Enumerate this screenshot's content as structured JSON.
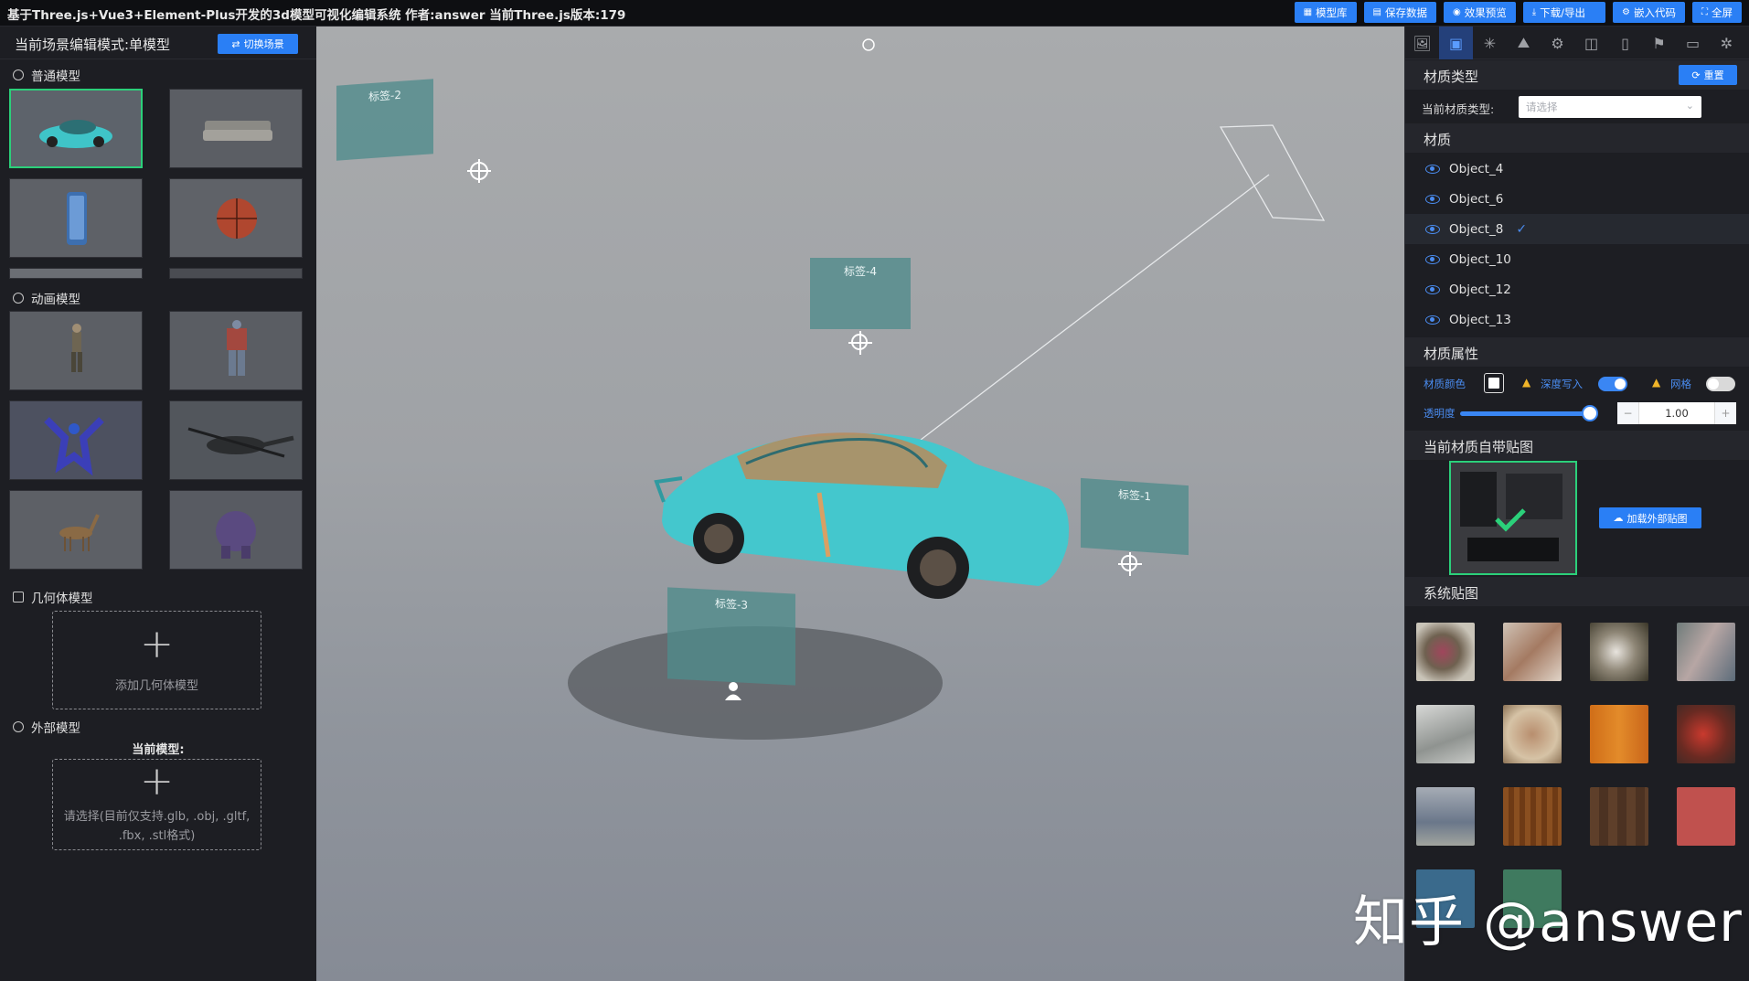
{
  "topbar": {
    "title": "基于Three.js+Vue3+Element-Plus开发的3d模型可视化编辑系统 作者:answer 当前Three.js版本:179",
    "buttons": [
      {
        "label": "模型库",
        "icon": "grid-icon"
      },
      {
        "label": "保存数据",
        "icon": "document-icon"
      },
      {
        "label": "效果预览",
        "icon": "eye-icon"
      },
      {
        "label": "下载/导出",
        "icon": "download-icon"
      },
      {
        "label": "嵌入代码",
        "icon": "gear-icon"
      },
      {
        "label": "全屏",
        "icon": "fullscreen-icon"
      }
    ]
  },
  "left": {
    "header_title": "当前场景编辑模式:单模型",
    "switch_label": "切换场景",
    "sections": {
      "normal": "普通模型",
      "animation": "动画模型",
      "geometry": "几何体模型",
      "external": "外部模型"
    },
    "add_geometry": "添加几何体模型",
    "current_model_label": "当前模型:",
    "upload_hint": "请选择(目前仅支持.glb, .obj, .gltf, .fbx, .stl格式)"
  },
  "viewport": {
    "labels": [
      "标签-2",
      "标签-4",
      "标签-1",
      "标签-3"
    ]
  },
  "right": {
    "material_type_title": "材质类型",
    "reset_label": "重置",
    "current_type_label": "当前材质类型:",
    "select_placeholder": "请选择",
    "material_title": "材质",
    "materials": [
      "Object_4",
      "Object_6",
      "Object_8",
      "Object_10",
      "Object_12",
      "Object_13"
    ],
    "selected_material": "Object_8",
    "props_title": "材质属性",
    "color_label": "材质颜色",
    "depth_label": "深度写入",
    "depth_on": true,
    "wire_label": "网格",
    "wire_on": false,
    "opacity_label": "透明度",
    "opacity_value": "1.00",
    "opacity_fraction": 1.0,
    "own_texture_title": "当前材质自带贴图",
    "load_texture_label": "加载外部贴图",
    "system_texture_title": "系统贴图"
  },
  "watermark": "知乎 @answer",
  "colors": {
    "accent": "#2a7ff5",
    "selected_green": "#2bd07a",
    "car_body": "#43c6cc"
  }
}
